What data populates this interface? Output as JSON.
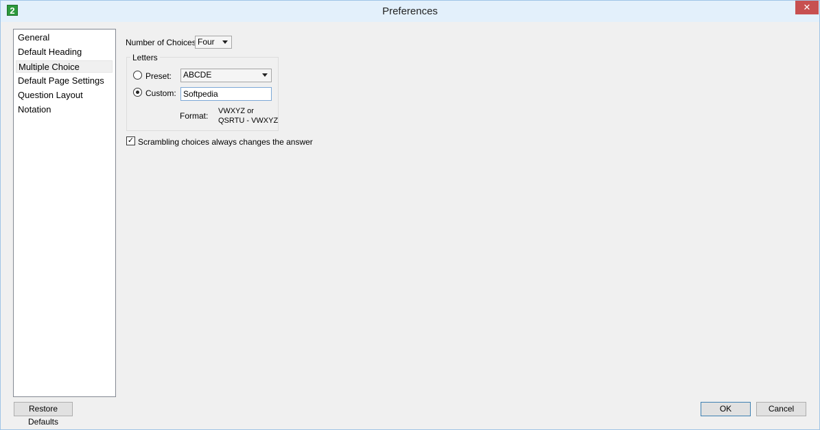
{
  "window": {
    "title": "Preferences",
    "app_icon_glyph": "2",
    "close_glyph": "✕"
  },
  "sidebar": {
    "items": [
      {
        "label": "General",
        "selected": false
      },
      {
        "label": "Default Heading",
        "selected": false
      },
      {
        "label": "Multiple Choice",
        "selected": true
      },
      {
        "label": "Default Page Settings",
        "selected": false
      },
      {
        "label": "Question Layout",
        "selected": false
      },
      {
        "label": "Notation",
        "selected": false
      }
    ]
  },
  "main": {
    "number_of_choices_label": "Number of Choices:",
    "number_of_choices_value": "Four",
    "letters_group_title": "Letters",
    "preset_label": "Preset:",
    "preset_value": "ABCDE",
    "preset_selected": false,
    "custom_label": "Custom:",
    "custom_value": "Softpedia",
    "custom_selected": true,
    "format_label": "Format:",
    "format_line1": "VWXYZ  or",
    "format_line2": "QSRTU - VWXYZ",
    "scramble_label": "Scrambling choices always changes the answer",
    "scramble_checked": true
  },
  "footer": {
    "restore_defaults_label": "Restore Defaults",
    "ok_label": "OK",
    "cancel_label": "Cancel"
  },
  "colors": {
    "titlebar": "#e3f0fb",
    "close_button": "#c75050",
    "app_icon": "#2c9a3c"
  }
}
